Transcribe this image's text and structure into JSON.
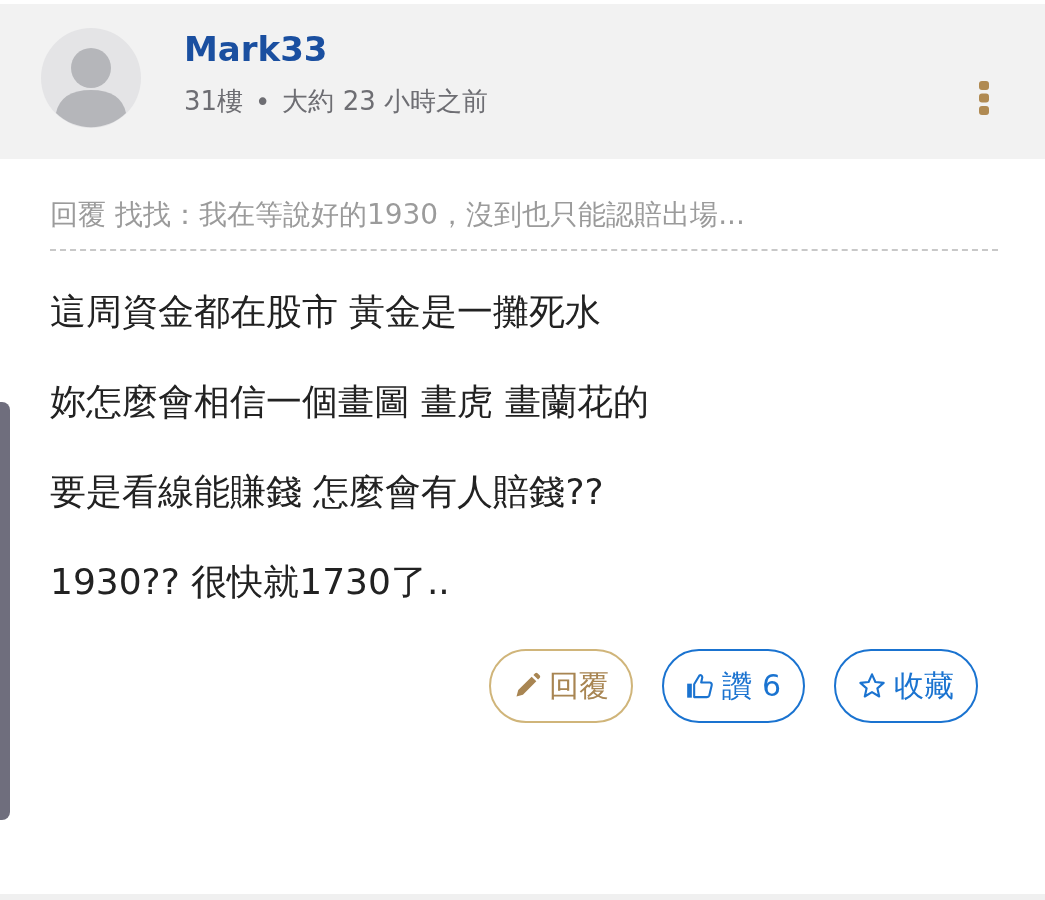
{
  "post": {
    "author": "Mark33",
    "floor": "31樓",
    "separator": "•",
    "time": "大約 23 小時之前"
  },
  "quote": "回覆 找找：我在等說好的1930，沒到也只能認賠出場...",
  "lines": [
    "這周資金都在股市 黃金是一攤死水",
    "妳怎麼會相信一個畫圖 畫虎 畫蘭花的",
    "要是看線能賺錢 怎麼會有人賠錢??",
    "1930?? 很快就1730了.."
  ],
  "actions": [
    {
      "kind": "reply",
      "label": "回覆"
    },
    {
      "kind": "like",
      "label": "讚 6"
    },
    {
      "kind": "favorite",
      "label": "收藏"
    }
  ]
}
